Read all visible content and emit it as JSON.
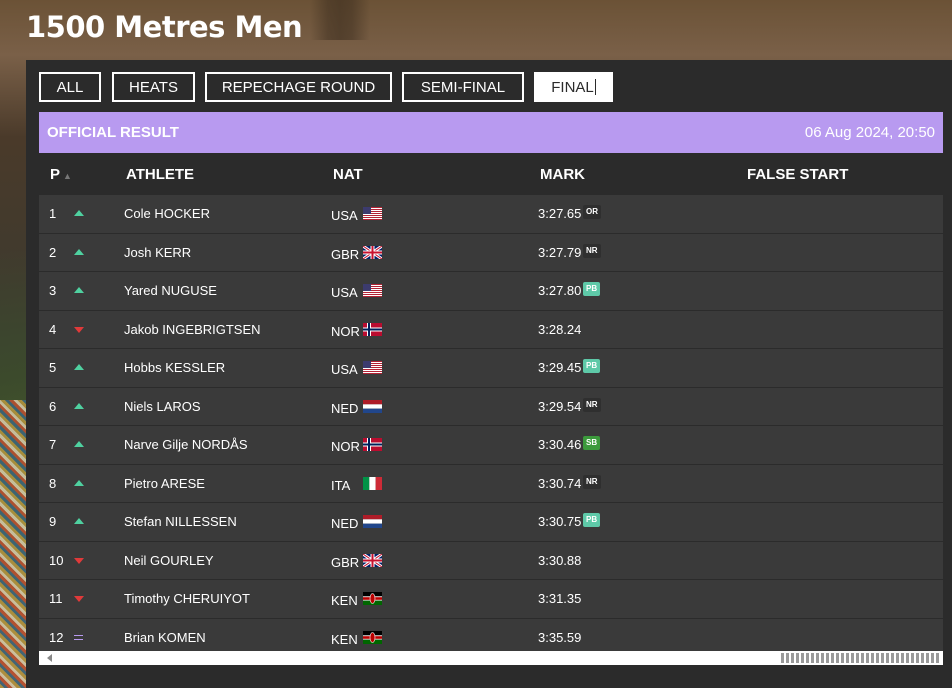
{
  "page": {
    "title": "1500 Metres Men"
  },
  "tabs": [
    {
      "label": "ALL"
    },
    {
      "label": "HEATS"
    },
    {
      "label": "REPECHAGE ROUND"
    },
    {
      "label": "SEMI-FINAL"
    },
    {
      "label": "FINAL"
    }
  ],
  "active_tab": "FINAL",
  "result_bar": {
    "label": "OFFICIAL RESULT",
    "datetime": "06 Aug 2024, 20:50"
  },
  "columns": {
    "position": "P",
    "athlete": "ATHLETE",
    "nat": "NAT",
    "mark": "MARK",
    "false_start": "FALSE START"
  },
  "rows": [
    {
      "pos": "1",
      "trend": "up",
      "athlete": "Cole HOCKER",
      "nat": "USA",
      "mark": "3:27.65",
      "badge": "OR"
    },
    {
      "pos": "2",
      "trend": "up",
      "athlete": "Josh KERR",
      "nat": "GBR",
      "mark": "3:27.79",
      "badge": "NR"
    },
    {
      "pos": "3",
      "trend": "up",
      "athlete": "Yared NUGUSE",
      "nat": "USA",
      "mark": "3:27.80",
      "badge": "PB"
    },
    {
      "pos": "4",
      "trend": "down",
      "athlete": "Jakob INGEBRIGTSEN",
      "nat": "NOR",
      "mark": "3:28.24",
      "badge": ""
    },
    {
      "pos": "5",
      "trend": "up",
      "athlete": "Hobbs KESSLER",
      "nat": "USA",
      "mark": "3:29.45",
      "badge": "PB"
    },
    {
      "pos": "6",
      "trend": "up",
      "athlete": "Niels LAROS",
      "nat": "NED",
      "mark": "3:29.54",
      "badge": "NR"
    },
    {
      "pos": "7",
      "trend": "up",
      "athlete": "Narve Gilje NORDÅS",
      "nat": "NOR",
      "mark": "3:30.46",
      "badge": "SB"
    },
    {
      "pos": "8",
      "trend": "up",
      "athlete": "Pietro ARESE",
      "nat": "ITA",
      "mark": "3:30.74",
      "badge": "NR"
    },
    {
      "pos": "9",
      "trend": "up",
      "athlete": "Stefan NILLESSEN",
      "nat": "NED",
      "mark": "3:30.75",
      "badge": "PB"
    },
    {
      "pos": "10",
      "trend": "down",
      "athlete": "Neil GOURLEY",
      "nat": "GBR",
      "mark": "3:30.88",
      "badge": ""
    },
    {
      "pos": "11",
      "trend": "down",
      "athlete": "Timothy CHERUIYOT",
      "nat": "KEN",
      "mark": "3:31.35",
      "badge": ""
    },
    {
      "pos": "12",
      "trend": "same",
      "athlete": "Brian KOMEN",
      "nat": "KEN",
      "mark": "3:35.59",
      "badge": ""
    }
  ],
  "colors": {
    "accent_purple": "#b89af0",
    "trend_up": "#4fd1a0",
    "trend_down": "#e03a3a",
    "panel_bg": "#2b2b2b",
    "row_bg": "#3a3a3a"
  }
}
